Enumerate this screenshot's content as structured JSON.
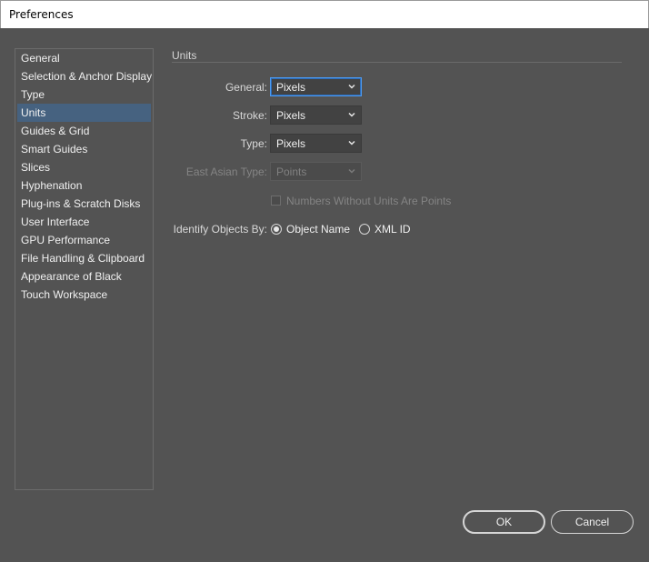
{
  "window": {
    "title": "Preferences"
  },
  "sidebar": {
    "items": [
      {
        "label": "General",
        "selected": false
      },
      {
        "label": "Selection & Anchor Display",
        "selected": false
      },
      {
        "label": "Type",
        "selected": false
      },
      {
        "label": "Units",
        "selected": true
      },
      {
        "label": "Guides & Grid",
        "selected": false
      },
      {
        "label": "Smart Guides",
        "selected": false
      },
      {
        "label": "Slices",
        "selected": false
      },
      {
        "label": "Hyphenation",
        "selected": false
      },
      {
        "label": "Plug-ins & Scratch Disks",
        "selected": false
      },
      {
        "label": "User Interface",
        "selected": false
      },
      {
        "label": "GPU Performance",
        "selected": false
      },
      {
        "label": "File Handling & Clipboard",
        "selected": false
      },
      {
        "label": "Appearance of Black",
        "selected": false
      },
      {
        "label": "Touch Workspace",
        "selected": false
      }
    ]
  },
  "units": {
    "section_title": "Units",
    "general": {
      "label": "General:",
      "value": "Pixels"
    },
    "stroke": {
      "label": "Stroke:",
      "value": "Pixels"
    },
    "type": {
      "label": "Type:",
      "value": "Pixels"
    },
    "east_asian_type": {
      "label": "East Asian Type:",
      "value": "Points",
      "disabled": true
    },
    "numbers_without_units": {
      "label": "Numbers Without Units Are Points",
      "checked": false,
      "disabled": true
    },
    "identify_objects_by": {
      "label": "Identify Objects By:",
      "options": [
        {
          "label": "Object Name",
          "checked": true
        },
        {
          "label": "XML ID",
          "checked": false
        }
      ]
    }
  },
  "buttons": {
    "ok": "OK",
    "cancel": "Cancel"
  },
  "colors": {
    "background": "#535353",
    "selection": "#466280",
    "focus": "#4d9cf4"
  }
}
